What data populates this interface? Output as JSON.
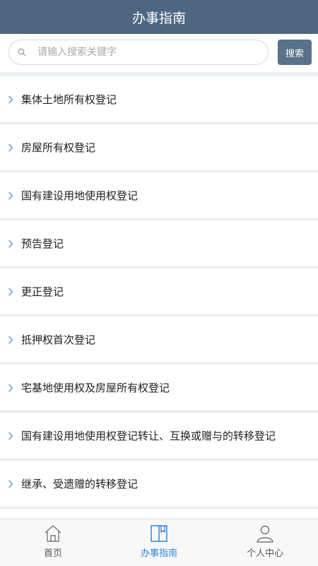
{
  "header": {
    "title": "办事指南"
  },
  "search": {
    "placeholder": "请输入搜索关键字",
    "button_label": "搜索"
  },
  "guides": [
    {
      "label": "集体土地所有权登记"
    },
    {
      "label": "房屋所有权登记"
    },
    {
      "label": "国有建设用地使用权登记"
    },
    {
      "label": "预告登记"
    },
    {
      "label": "更正登记"
    },
    {
      "label": "抵押权首次登记"
    },
    {
      "label": "宅基地使用权及房屋所有权登记"
    },
    {
      "label": "国有建设用地使用权登记转让、互换或赠与的转移登记"
    },
    {
      "label": "继承、受遗赠的转移登记"
    }
  ],
  "tabbar": {
    "tabs": [
      {
        "label": "首页",
        "icon": "home-icon"
      },
      {
        "label": "办事指南",
        "icon": "guide-book-icon",
        "active": true
      },
      {
        "label": "个人中心",
        "icon": "user-icon"
      }
    ]
  },
  "colors": {
    "header": "#4e6680",
    "active_tab": "#2e86de",
    "chevron": "#6a8fc4"
  }
}
